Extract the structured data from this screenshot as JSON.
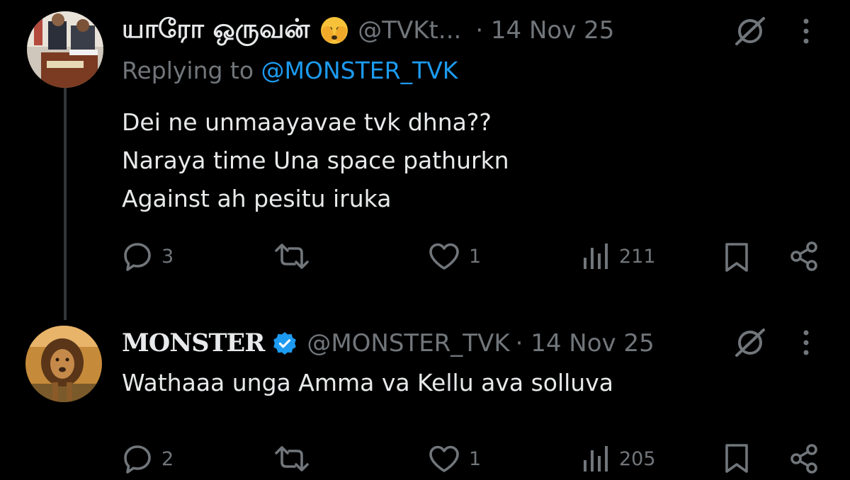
{
  "colors": {
    "background": "#000000",
    "text": "#e7e9ea",
    "muted": "#71767b",
    "link": "#1d9bf0",
    "verified": "#1d9bf0",
    "thread_line": "#333639"
  },
  "parent_tweet": {
    "display_name": "யாரோ ஒருவன்",
    "emoji": "face-with-peeking-eye",
    "handle": "@TVKt...",
    "date": "· 14 Nov 25",
    "replying_prefix": "Replying to ",
    "replying_to": "@MONSTER_TVK",
    "lines": [
      "Dei ne unmaayavae tvk dhna??",
      "Naraya time Una space pathurkn",
      "Against ah pesitu iruka"
    ],
    "actions": {
      "replies": "3",
      "likes": "1",
      "views": "211"
    },
    "icons": [
      "grok-icon",
      "more-icon",
      "reply-icon",
      "retweet-icon",
      "like-icon",
      "views-icon",
      "bookmark-icon",
      "share-icon"
    ]
  },
  "reply_tweet": {
    "display_name": "MONSTER",
    "verified": true,
    "handle": "@MONSTER_TVK",
    "date": "· 14 Nov 25",
    "text": "Wathaaa unga Amma va Kellu ava solluva",
    "actions": {
      "replies": "2",
      "likes": "1",
      "views": "205"
    }
  }
}
